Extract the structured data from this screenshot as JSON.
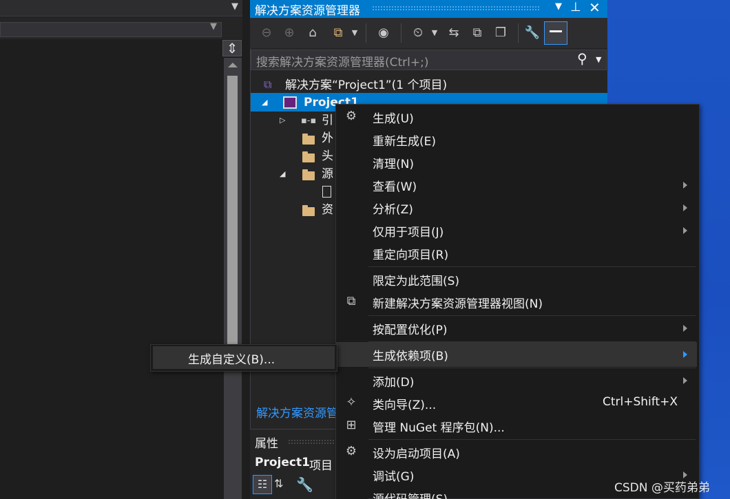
{
  "left_editor": {
    "split_icon": "split-handle-icon"
  },
  "solution_explorer": {
    "title": "解决方案资源管理器",
    "search_placeholder": "搜索解决方案资源管理器(Ctrl+;)",
    "toolbar_icons": [
      "back-icon",
      "forward-icon",
      "home-icon",
      "switch-views-icon",
      "dropdown-icon",
      "globe-icon",
      "pending-changes-icon",
      "sync-icon",
      "collapse-all-icon",
      "show-all-files-icon",
      "properties-wrench-icon",
      "preview-selected-icon"
    ],
    "tree": {
      "solution": "解决方案“Project1”(1 个项目)",
      "project": "Project1",
      "items": [
        {
          "label": "引",
          "icon": "references-icon"
        },
        {
          "label": "外",
          "icon": "external-deps-icon"
        },
        {
          "label": "头",
          "icon": "folder-icon"
        },
        {
          "label": "源",
          "icon": "folder-open-icon"
        },
        {
          "label": "",
          "icon": "file-icon"
        },
        {
          "label": "资",
          "icon": "folder-icon"
        }
      ]
    },
    "footer_tab": "解决方案资源管"
  },
  "properties": {
    "title": "属性",
    "object": "Project1",
    "object_suffix": "项目"
  },
  "context_menu": {
    "items": [
      {
        "label": "生成(U)",
        "icon": "build-icon",
        "submenu": false
      },
      {
        "label": "重新生成(E)",
        "submenu": false
      },
      {
        "label": "清理(N)",
        "submenu": false
      },
      {
        "label": "查看(W)",
        "submenu": true
      },
      {
        "label": "分析(Z)",
        "submenu": true
      },
      {
        "label": "仅用于项目(J)",
        "submenu": true
      },
      {
        "label": "重定向项目(R)",
        "submenu": false
      },
      {
        "label": "限定为此范围(S)",
        "submenu": false
      },
      {
        "label": "新建解决方案资源管理器视图(N)",
        "icon": "new-view-icon",
        "submenu": false
      },
      {
        "label": "按配置优化(P)",
        "submenu": true
      },
      {
        "label": "生成依赖项(B)",
        "submenu": true,
        "highlighted": true
      },
      {
        "label": "添加(D)",
        "submenu": true
      },
      {
        "label": "类向导(Z)...",
        "shortcut": "Ctrl+Shift+X",
        "icon": "class-wizard-icon"
      },
      {
        "label": "管理 NuGet 程序包(N)...",
        "icon": "nuget-package-icon"
      },
      {
        "label": "设为启动项目(A)",
        "icon": "gear-icon"
      },
      {
        "label": "调试(G)",
        "submenu": true
      },
      {
        "label": "源代码管理(S)",
        "submenu": true
      }
    ]
  },
  "submenu": {
    "item": "生成自定义(B)..."
  },
  "watermark": "CSDN @买药弟弟",
  "colors": {
    "accent": "#007acc",
    "menu_bg": "#1b1b1c",
    "highlight": "#333334",
    "desktop_blue": "#1d55c4"
  }
}
